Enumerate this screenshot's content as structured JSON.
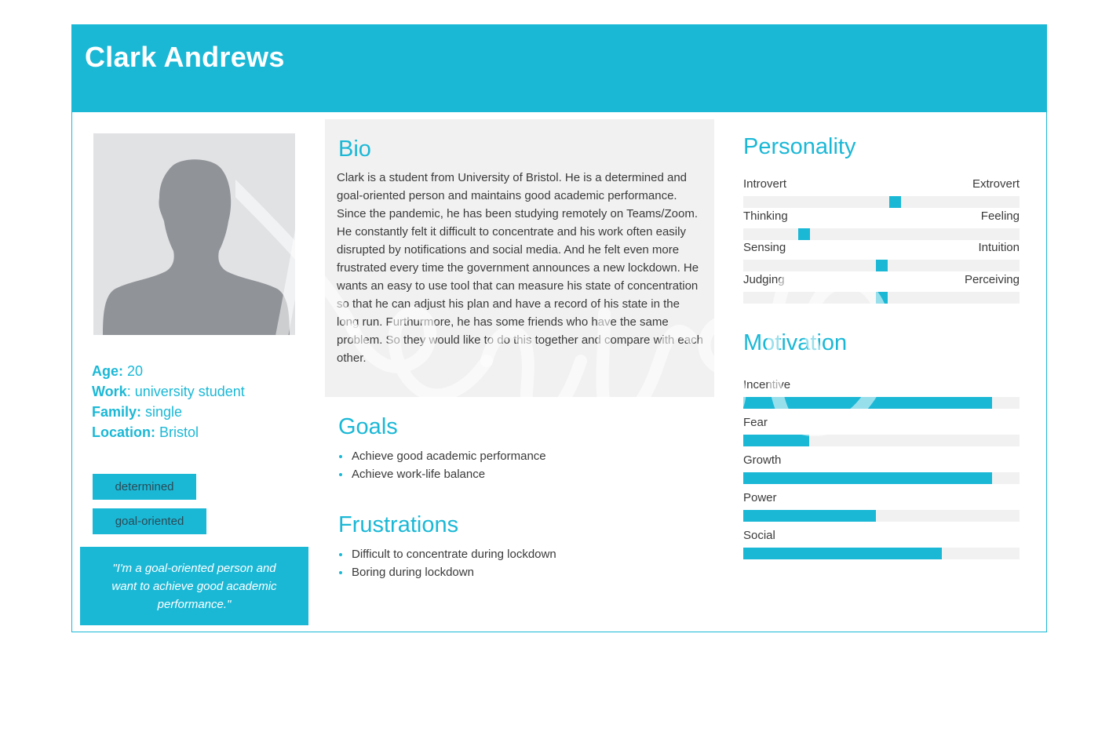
{
  "header": {
    "name": "Clark Andrews"
  },
  "profile": {
    "photo_icon": "person-silhouette-icon",
    "facts": [
      {
        "label": "Age:",
        "value": " 20"
      },
      {
        "label": "Work",
        "value": ": university student"
      },
      {
        "label": "Family:",
        "value": " single"
      },
      {
        "label": "Location:",
        "value": " Bristol"
      }
    ],
    "tags": [
      "determined",
      "goal-oriented"
    ],
    "quote": "\"I'm a goal-oriented person and want to achieve good academic performance.\""
  },
  "bio": {
    "title": "Bio",
    "text": "Clark is a student from University of Bristol. He is a determined and goal-oriented person and maintains good academic performance. Since the pandemic, he has been studying remotely on Teams/Zoom. He constantly felt it difficult to concentrate and his work often easily disrupted by notifications and social media. And he felt even more frustrated every time the government announces a new lockdown. He wants an easy to use tool that can measure his state of concentration so that he can adjust his plan and have a record of his state in the long run. Furthurmore, he has some friends who have the same problem. So they would like to do this together and compare with each other."
  },
  "goals": {
    "title": "Goals",
    "items": [
      "Achieve good academic performance",
      "Achieve work-life balance"
    ]
  },
  "frustrations": {
    "title": "Frustrations",
    "items": [
      "Difficult to concentrate during lockdown",
      "Boring during lockdown"
    ]
  },
  "personality": {
    "title": "Personality",
    "traits": [
      {
        "left": "Introvert",
        "right": "Extrovert",
        "position": 0.55
      },
      {
        "left": "Thinking",
        "right": "Feeling",
        "position": 0.22
      },
      {
        "left": "Sensing",
        "right": "Intuition",
        "position": 0.5
      },
      {
        "left": "Judging",
        "right": "Perceiving",
        "position": 0.5
      }
    ]
  },
  "motivation": {
    "title": "Motivation",
    "items": [
      {
        "label": "Incentive",
        "level": 0.9
      },
      {
        "label": "Fear",
        "level": 0.24
      },
      {
        "label": "Growth",
        "level": 0.9
      },
      {
        "label": "Power",
        "level": 0.48
      },
      {
        "label": "Social",
        "level": 0.72
      }
    ]
  },
  "colors": {
    "accent": "#1bb8d6",
    "panel": "#f1f1f1",
    "text": "#3a3a3a"
  }
}
